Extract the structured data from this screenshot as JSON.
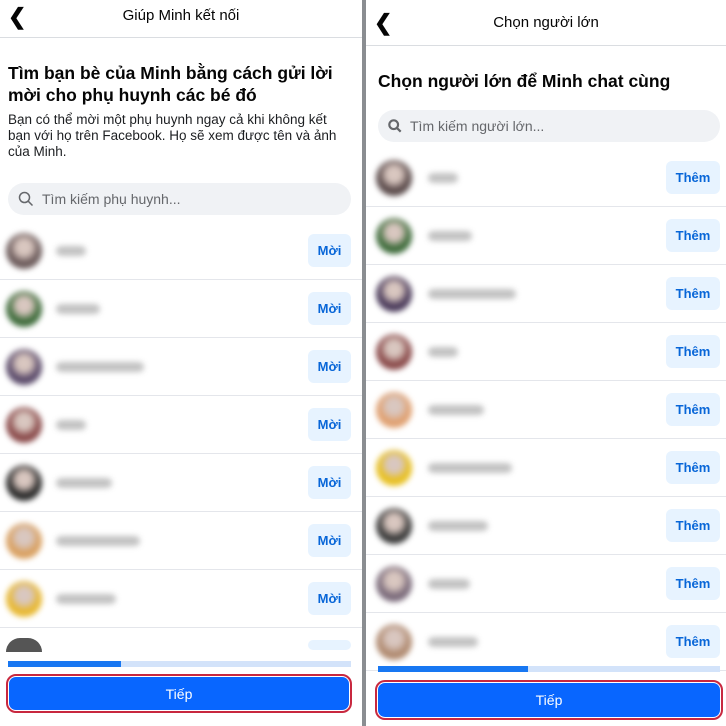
{
  "left": {
    "header_title": "Giúp Minh kết nối",
    "heading": "Tìm bạn bè của Minh bằng cách gửi lời mời cho phụ huynh các bé đó",
    "description": "Bạn có thể mời một phụ huynh ngay cả khi không kết bạn với họ trên Facebook. Họ sẽ xem được tên và ảnh của Minh.",
    "search_placeholder": "Tìm kiếm phụ huynh...",
    "invite_label": "Mời",
    "avatar_colors": [
      "#6b5a5a",
      "#3d6b3a",
      "#5a4a6a",
      "#8a4a4a",
      "#2a2a2a",
      "#d9a060",
      "#e8b830"
    ],
    "progress": 0.33,
    "next_label": "Tiếp"
  },
  "right": {
    "header_title": "Chọn người lớn",
    "heading": "Chọn người lớn để Minh chat cùng",
    "search_placeholder": "Tìm kiếm người lớn...",
    "add_label": "Thêm",
    "avatar_colors": [
      "#5a4a4a",
      "#3d6b3a",
      "#4a3a5a",
      "#8a4a4a",
      "#e0a070",
      "#e8c020",
      "#3a3a3a",
      "#7a6a7a",
      "#b08a70"
    ],
    "progress": 0.44,
    "next_label": "Tiếp"
  },
  "colors": {
    "primary": "#0866ff",
    "highlight": "#c8283f"
  }
}
